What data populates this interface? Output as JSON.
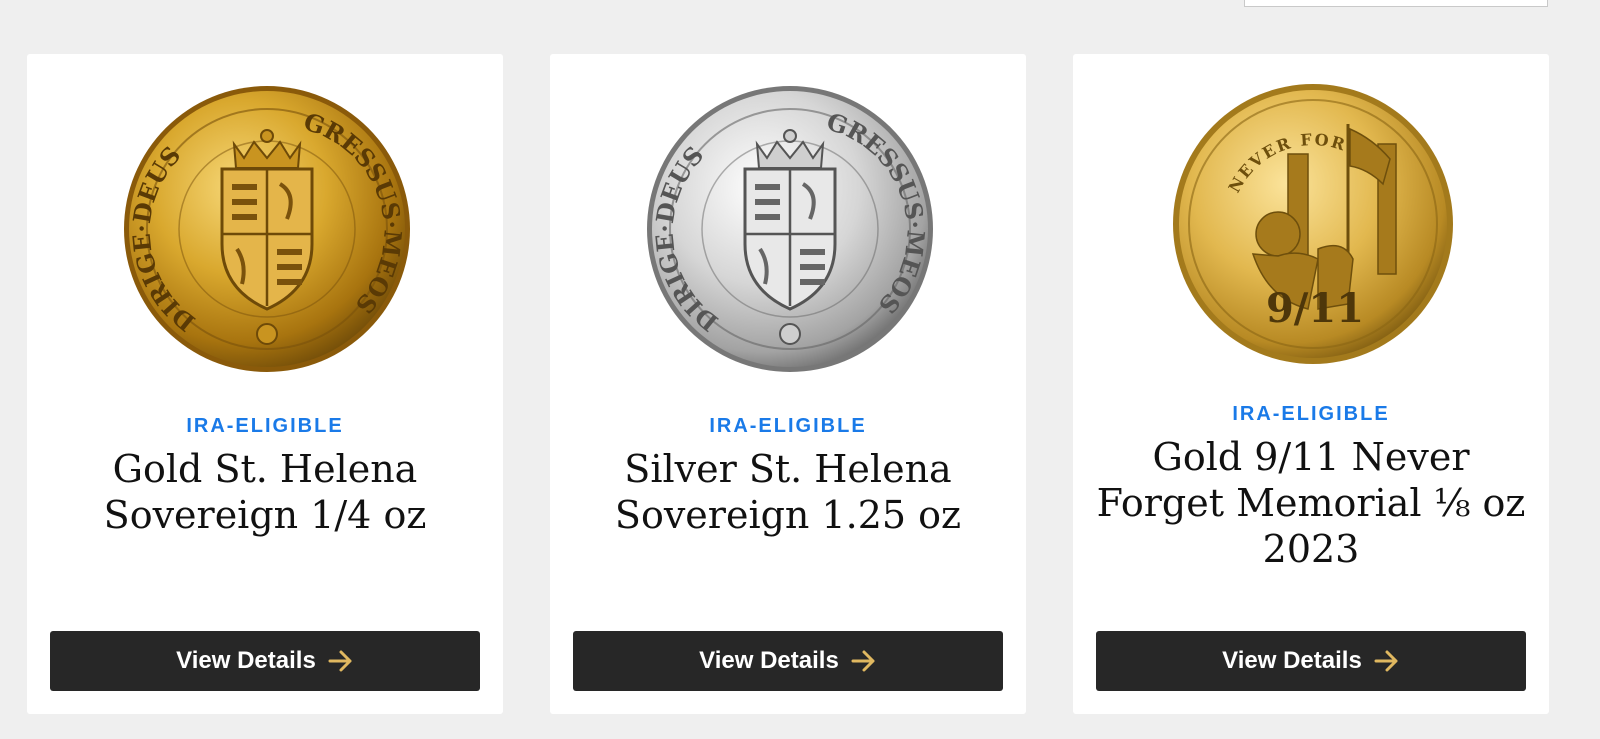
{
  "colors": {
    "background": "#efefef",
    "card": "#ffffff",
    "badge": "#1a7ae8",
    "button_bg": "#272727",
    "button_text": "#ffffff",
    "arrow": "#e0b860",
    "gold": "#d4a526",
    "silver": "#c8c8c8"
  },
  "products": [
    {
      "badge": "IRA-ELIGIBLE",
      "title": "Gold St. Helena Sovereign 1/4 oz",
      "button_label": "View Details",
      "image_icon": "gold-sovereign-coin-icon",
      "coin_legend_left": "DIRIGE·DEUS",
      "coin_legend_right": "GRESSUS·MEOS"
    },
    {
      "badge": "IRA-ELIGIBLE",
      "title": "Silver St. Helena Sovereign 1.25 oz",
      "button_label": "View Details",
      "image_icon": "silver-sovereign-coin-icon",
      "coin_legend_left": "DIRIGE·DEUS",
      "coin_legend_right": "GRESSUS·MEOS"
    },
    {
      "badge": "IRA-ELIGIBLE",
      "title": "Gold 9/11 Never Forget Memorial ⅛ oz 2023",
      "button_label": "View Details",
      "image_icon": "gold-memorial-coin-icon",
      "coin_legend_top": "NEVER FORGET",
      "coin_mark": "9/11"
    }
  ]
}
